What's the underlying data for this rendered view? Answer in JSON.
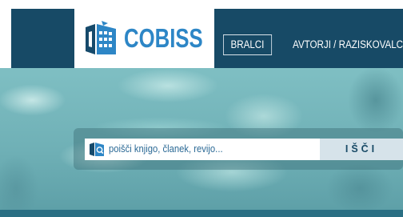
{
  "logo": {
    "text": "COBISS",
    "icon": "cobiss-book-icon"
  },
  "nav": {
    "readers_label": "BRALCI",
    "authors_label": "AVTORJI / RAZISKOVALCI"
  },
  "search": {
    "placeholder": "poišči knjigo, članek, revijo...",
    "button_label": "IŠČI",
    "icon": "book-search-icon"
  },
  "colors": {
    "header_bg": "#174a66",
    "logo_text": "#2d86c6",
    "button_bg": "#d6e3ea"
  }
}
